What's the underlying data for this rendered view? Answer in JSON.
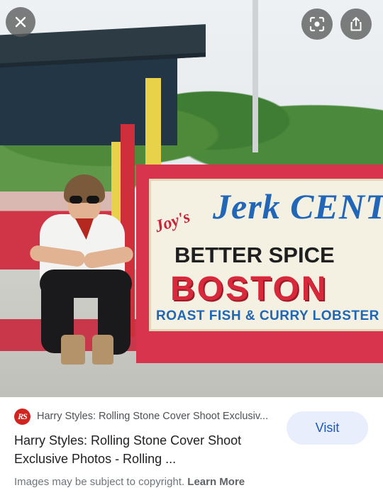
{
  "overlay": {
    "close_icon": "close-icon",
    "lens_icon": "lens-search-icon",
    "share_icon": "share-icon"
  },
  "photo_sign": {
    "line1_small": "Joy's",
    "line1": "Jerk CENT",
    "line2": "BETTER SPICE",
    "line3": "BOSTON",
    "line4": "ROAST FISH & CURRY LOBSTER (Cooked"
  },
  "result": {
    "source_logo": "RS",
    "source_name": "Harry Styles: Rolling Stone Cover Shoot Exclusiv...",
    "title": "Harry Styles: Rolling Stone Cover Shoot Exclusive Photos - Rolling ...",
    "visit_label": "Visit",
    "copyright_text": "Images may be subject to copyright.",
    "learn_more": "Learn More"
  },
  "colors": {
    "accent": "#1a56c6",
    "visit_bg": "#e8eefb",
    "brand_rs": "#d2241f"
  }
}
